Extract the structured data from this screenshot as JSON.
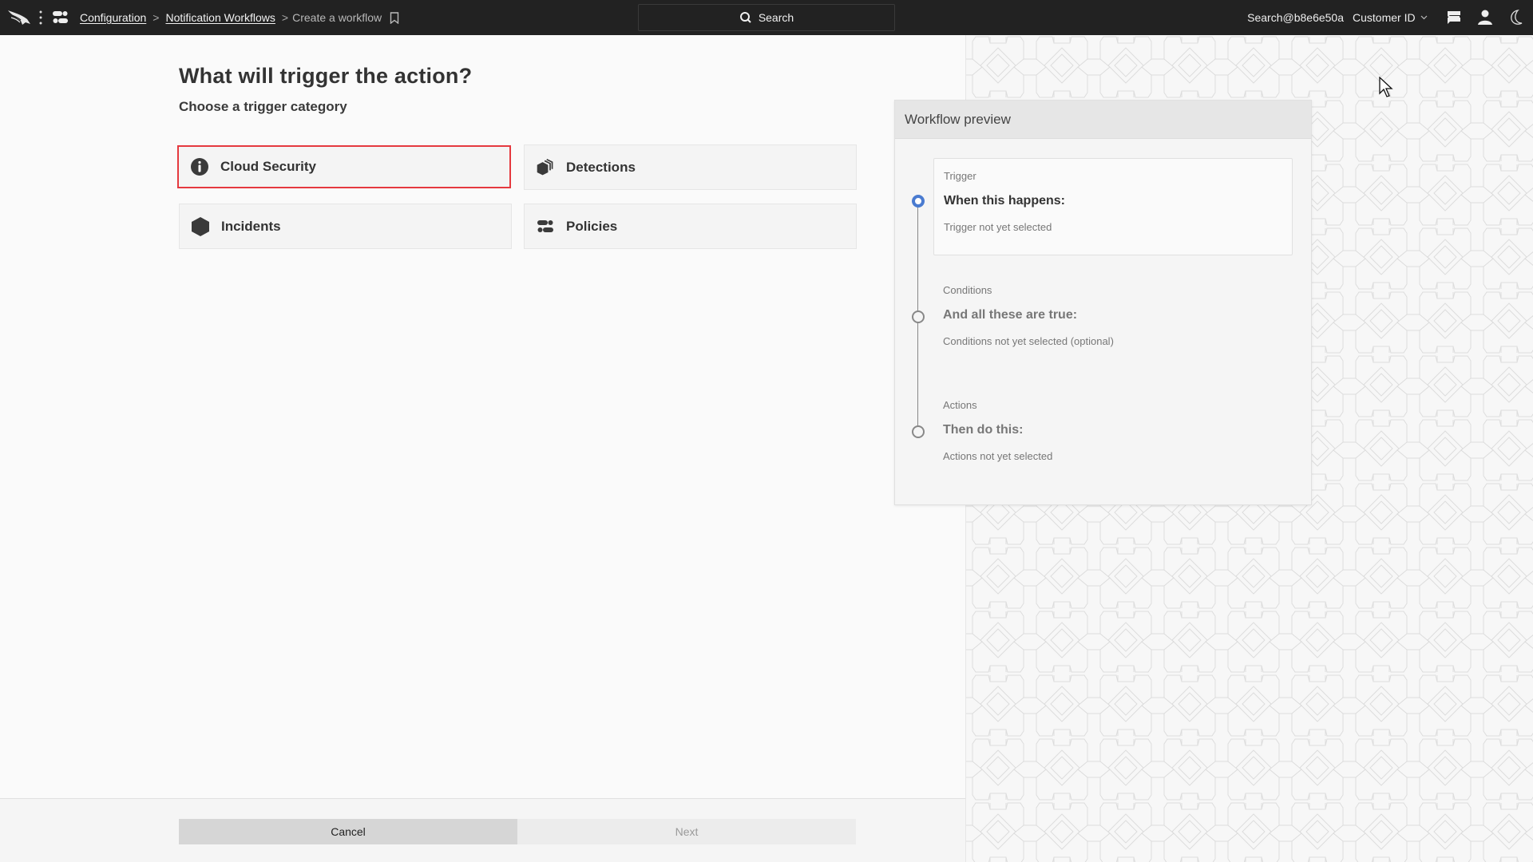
{
  "header": {
    "logo_icon": "falcon-logo-icon",
    "menu_icon": "kebab-menu-icon",
    "apps_icon": "toggles-icon",
    "breadcrumb": [
      {
        "label": "Configuration",
        "link": true
      },
      {
        "label": "Notification Workflows",
        "link": true
      },
      {
        "label": "Create a workflow",
        "link": false
      }
    ],
    "breadcrumb_separator": ">",
    "bookmark_icon": "bookmark-icon",
    "search": {
      "label": "Search",
      "icon": "search-icon"
    },
    "user": "Search@b8e6e50a",
    "customer_id": {
      "label": "Customer ID",
      "icon": "chevron-down-icon"
    },
    "icons": [
      "messages-icon",
      "user-icon",
      "moon-icon"
    ]
  },
  "main": {
    "title": "What will trigger the action?",
    "subtitle": "Choose a trigger category",
    "categories": [
      {
        "label": "Cloud Security",
        "icon": "info-icon",
        "selected": true
      },
      {
        "label": "Detections",
        "icon": "layers-hex-icon",
        "selected": false
      },
      {
        "label": "Incidents",
        "icon": "hexagon-icon",
        "selected": false
      },
      {
        "label": "Policies",
        "icon": "toggles-icon",
        "selected": false
      }
    ],
    "selected_border_color": "#e5393f"
  },
  "footer": {
    "cancel_label": "Cancel",
    "next_label": "Next",
    "next_enabled": false
  },
  "preview": {
    "title": "Workflow preview",
    "steps": [
      {
        "kicker": "Trigger",
        "heading": "When this happens:",
        "note": "Trigger not yet selected",
        "active": true
      },
      {
        "kicker": "Conditions",
        "heading": "And all these are true:",
        "note": "Conditions not yet selected (optional)",
        "active": false
      },
      {
        "kicker": "Actions",
        "heading": "Then do this:",
        "note": "Actions not yet selected",
        "active": false
      }
    ],
    "active_color": "#4a7bd0"
  }
}
